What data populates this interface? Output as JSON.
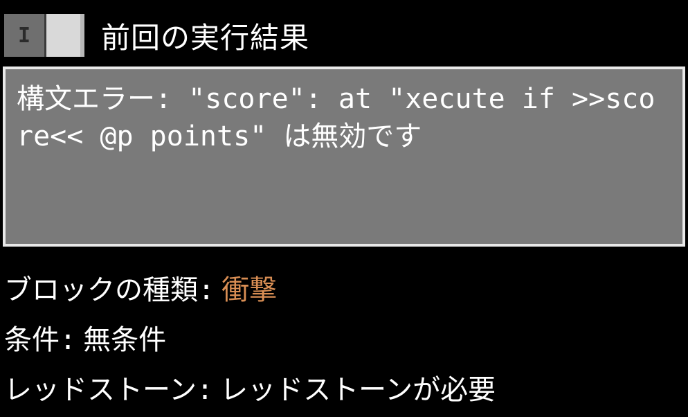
{
  "header": {
    "toggle_off_glyph": "I",
    "title": "前回の実行結果"
  },
  "output": {
    "text": "構文エラー: \"score\": at \"xecute if >>score<< @p points\" は無効です"
  },
  "settings": {
    "block_type": {
      "label": "ブロックの種類:",
      "value": "衝撃"
    },
    "condition": {
      "label": "条件:",
      "value": "無条件"
    },
    "redstone": {
      "label": "レッドストーン:",
      "value": "レッドストーンが必要"
    }
  }
}
